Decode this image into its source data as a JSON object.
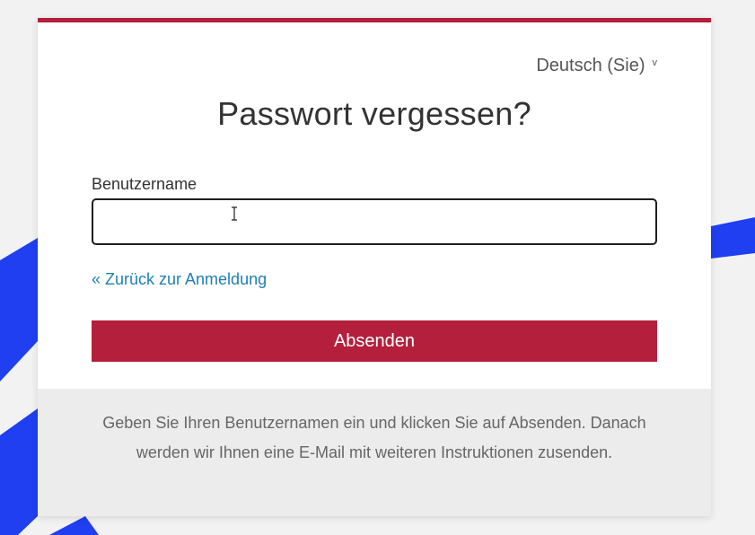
{
  "language": {
    "selected": "Deutsch (Sie)",
    "caret": "v"
  },
  "page": {
    "title": "Passwort vergessen?"
  },
  "form": {
    "username_label": "Benutzername",
    "username_value": "",
    "back_link": "« Zurück zur Anmeldung",
    "submit_label": "Absenden"
  },
  "info": {
    "text": "Geben Sie Ihren Benutzernamen ein und klicken Sie auf Absenden. Danach werden wir Ihnen eine E-Mail mit weiteren Instruktionen zusenden."
  },
  "colors": {
    "accent": "#b41f3c",
    "link": "#1f7fb4",
    "background_stripes": "#1f3ff0"
  },
  "icons": {
    "text_cursor": "text-cursor-icon",
    "dropdown": "chevron-down-icon"
  }
}
